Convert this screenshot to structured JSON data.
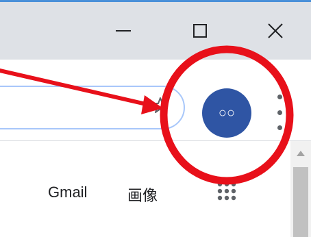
{
  "window": {
    "minimize_label": "minimize",
    "maximize_label": "maximize",
    "close_label": "close"
  },
  "toolbar": {
    "bookmark_icon": "star-icon",
    "profile_avatar_text": "○○",
    "menu_icon": "kebab-menu-icon"
  },
  "page": {
    "gmail_link": "Gmail",
    "images_link": "画像",
    "apps_icon": "apps-grid-icon"
  },
  "annotation": {
    "arrow_color": "#e8101a",
    "circle_color": "#e8101a"
  },
  "colors": {
    "titlebar": "#dee1e6",
    "avatar": "#2f55a4",
    "omnibox_border": "#a8c7fa"
  }
}
